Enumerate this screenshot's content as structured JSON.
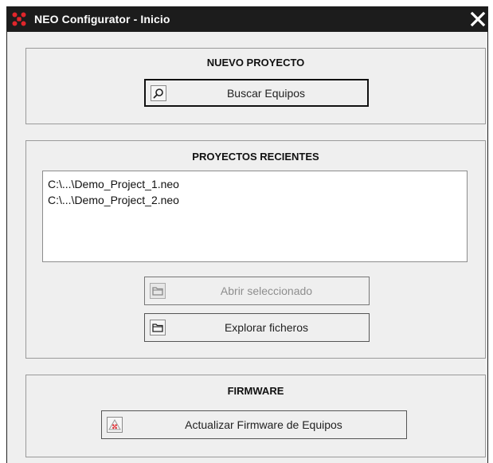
{
  "window": {
    "title": "NEO Configurator - Inicio",
    "close_symbol": "✕",
    "app_icon": "red-crosshair-icon",
    "close_icon": "close-x-icon"
  },
  "new_project": {
    "title": "NUEVO PROYECTO",
    "search_button": {
      "label": "Buscar Equipos",
      "icon": "search-icon"
    }
  },
  "recent_projects": {
    "title": "PROYECTOS RECIENTES",
    "items": [
      "C:\\...\\Demo_Project_1.neo",
      "C:\\...\\Demo_Project_2.neo"
    ],
    "open_selected_button": {
      "label": "Abrir seleccionado",
      "icon": "folder-icon",
      "enabled": false
    },
    "browse_files_button": {
      "label": "Explorar ficheros",
      "icon": "folder-icon"
    }
  },
  "firmware": {
    "title": "FIRMWARE",
    "update_button": {
      "label": "Actualizar Firmware de Equipos",
      "icon": "device-update-icon"
    }
  },
  "colors": {
    "titlebar": "#1c1c1c",
    "window_bg": "#efefef",
    "accent_red": "#e0262b"
  }
}
